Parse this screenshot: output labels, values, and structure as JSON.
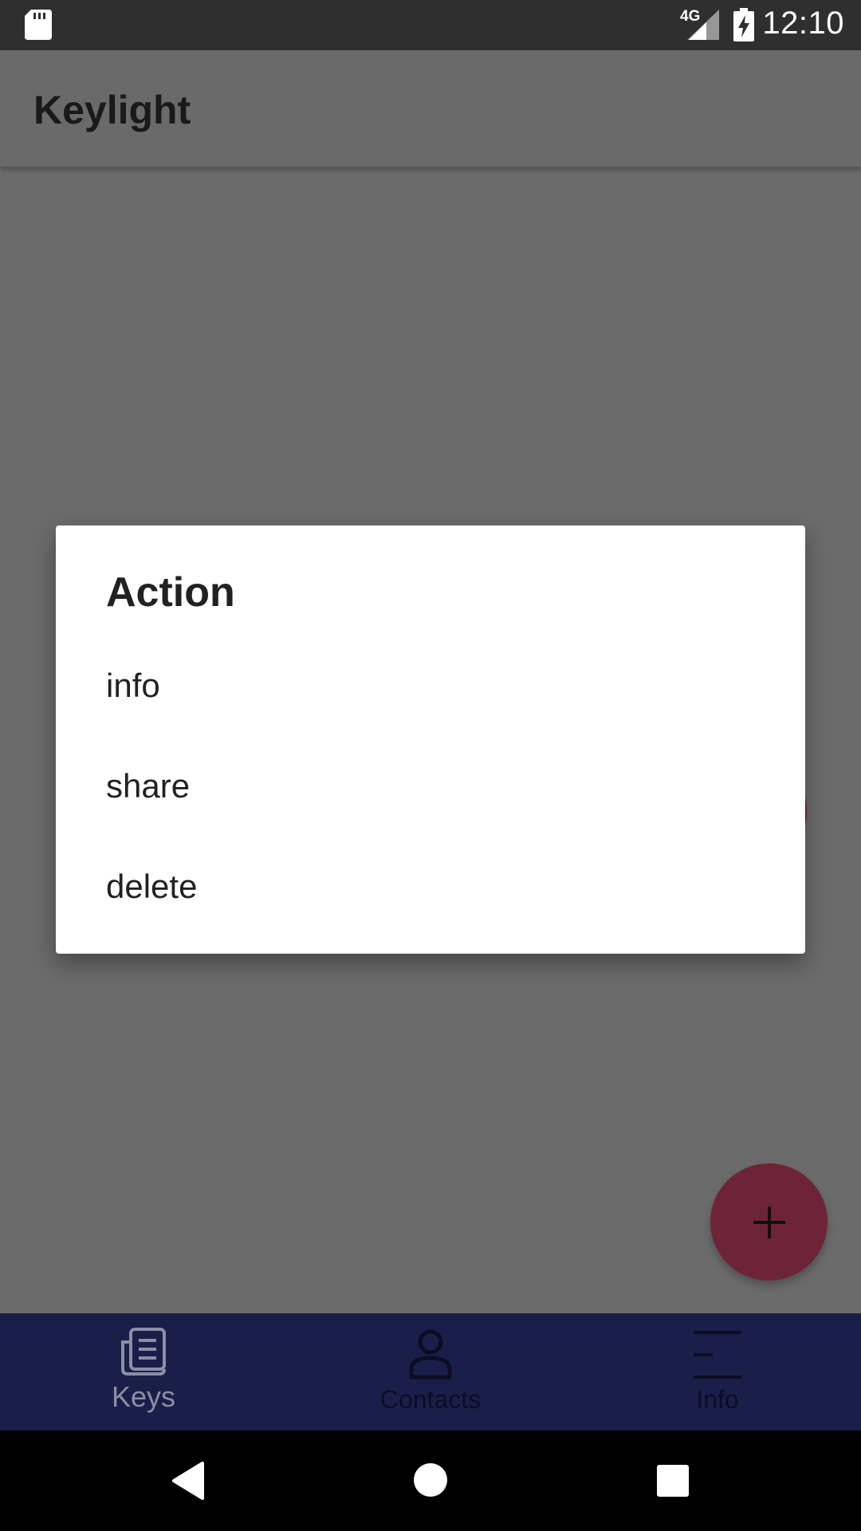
{
  "status_bar": {
    "time": "12:10",
    "network": "4G",
    "icons": [
      "sd-card-icon",
      "signal-icon",
      "battery-charging-icon"
    ]
  },
  "app_bar": {
    "title": "Keylight"
  },
  "dialog": {
    "title": "Action",
    "items": [
      {
        "label": "info"
      },
      {
        "label": "share"
      },
      {
        "label": "delete"
      }
    ]
  },
  "fab": {
    "icon": "plus-icon",
    "color": "#6e2438"
  },
  "bottom_nav": {
    "background": "#1a1f4a",
    "items": [
      {
        "label": "Keys",
        "icon": "keys-icon",
        "color": "#8a8fa6"
      },
      {
        "label": "Contacts",
        "icon": "person-icon",
        "color": "#0b0d24"
      },
      {
        "label": "Info",
        "icon": "menu-lines-icon",
        "color": "#0b0d24"
      }
    ]
  },
  "system_nav": {
    "icons": [
      "back-icon",
      "home-icon",
      "recents-icon"
    ]
  }
}
